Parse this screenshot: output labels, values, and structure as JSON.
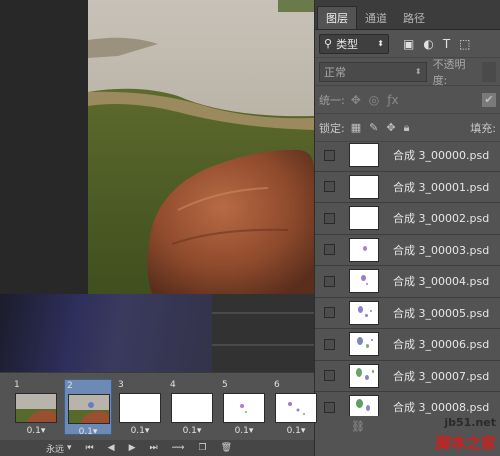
{
  "layers_panel": {
    "tabs": [
      "图层",
      "通道",
      "路径"
    ],
    "filter_kind": "类型",
    "blend_mode": "正常",
    "opacity_label": "不透明度:",
    "unify_label": "统一:",
    "lock_label": "锁定:",
    "fill_label": "填充:",
    "layers": [
      {
        "name": "合成 3_00000.psd"
      },
      {
        "name": "合成 3_00001.psd"
      },
      {
        "name": "合成 3_00002.psd"
      },
      {
        "name": "合成 3_00003.psd"
      },
      {
        "name": "合成 3_00004.psd"
      },
      {
        "name": "合成 3_00005.psd"
      },
      {
        "name": "合成 3_00006.psd"
      },
      {
        "name": "合成 3_00007.psd"
      },
      {
        "name": "合成 3_00008.psd"
      }
    ]
  },
  "timeline": {
    "frames": [
      {
        "number": "1",
        "delay": "0.1"
      },
      {
        "number": "2",
        "delay": "0.1"
      },
      {
        "number": "3",
        "delay": "0.1"
      },
      {
        "number": "4",
        "delay": "0.1"
      },
      {
        "number": "5",
        "delay": "0.1"
      },
      {
        "number": "6",
        "delay": "0.1"
      }
    ],
    "loop_option": "永远"
  },
  "watermark": {
    "url": "jb51.net",
    "text": "脚本之家"
  },
  "colors": {
    "panel_bg": "#535353",
    "selected_frame": "#6c8ab3",
    "watermark_red": "#d11e1e"
  }
}
